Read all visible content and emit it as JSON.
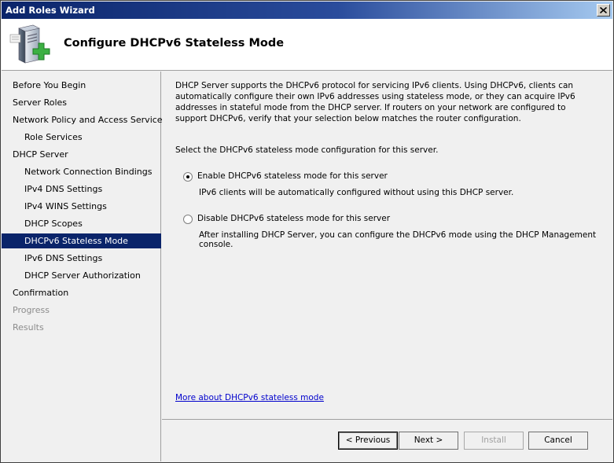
{
  "window": {
    "title": "Add Roles Wizard"
  },
  "header": {
    "title": "Configure DHCPv6 Stateless Mode",
    "icon": "server-add-icon"
  },
  "nav": {
    "items": [
      {
        "label": "Before You Begin",
        "level": 0,
        "state": "normal"
      },
      {
        "label": "Server Roles",
        "level": 0,
        "state": "normal"
      },
      {
        "label": "Network Policy and Access Services",
        "level": 0,
        "state": "normal"
      },
      {
        "label": "Role Services",
        "level": 1,
        "state": "normal"
      },
      {
        "label": "DHCP Server",
        "level": 0,
        "state": "normal"
      },
      {
        "label": "Network Connection Bindings",
        "level": 1,
        "state": "normal"
      },
      {
        "label": "IPv4 DNS Settings",
        "level": 1,
        "state": "normal"
      },
      {
        "label": "IPv4 WINS Settings",
        "level": 1,
        "state": "normal"
      },
      {
        "label": "DHCP Scopes",
        "level": 1,
        "state": "normal"
      },
      {
        "label": "DHCPv6 Stateless Mode",
        "level": 1,
        "state": "active"
      },
      {
        "label": "IPv6 DNS Settings",
        "level": 1,
        "state": "normal"
      },
      {
        "label": "DHCP Server Authorization",
        "level": 1,
        "state": "normal"
      },
      {
        "label": "Confirmation",
        "level": 0,
        "state": "normal"
      },
      {
        "label": "Progress",
        "level": 0,
        "state": "disabled"
      },
      {
        "label": "Results",
        "level": 0,
        "state": "disabled"
      }
    ]
  },
  "content": {
    "intro": "DHCP Server supports the DHCPv6 protocol for servicing IPv6 clients. Using DHCPv6, clients can automatically configure their own IPv6 addresses using stateless mode, or they can acquire IPv6 addresses in stateful mode from the DHCP server. If routers on your network are configured to support DHCPv6, verify that your selection below matches the router configuration.",
    "prompt": "Select the DHCPv6 stateless mode configuration for this server.",
    "options": [
      {
        "label": "Enable DHCPv6 stateless mode for this server",
        "description": "IPv6 clients will be automatically configured without using this DHCP server.",
        "selected": true
      },
      {
        "label": "Disable DHCPv6 stateless mode for this server",
        "description": "After installing DHCP Server, you can configure the DHCPv6 mode using the DHCP Management console.",
        "selected": false
      }
    ],
    "more_link": "More about DHCPv6 stateless mode"
  },
  "footer": {
    "previous": "< Previous",
    "next": "Next >",
    "install": "Install",
    "cancel": "Cancel"
  },
  "colors": {
    "selection": "#0a246a",
    "link": "#0000cc",
    "titlebar_start": "#0a246a",
    "titlebar_end": "#a6caf0"
  }
}
